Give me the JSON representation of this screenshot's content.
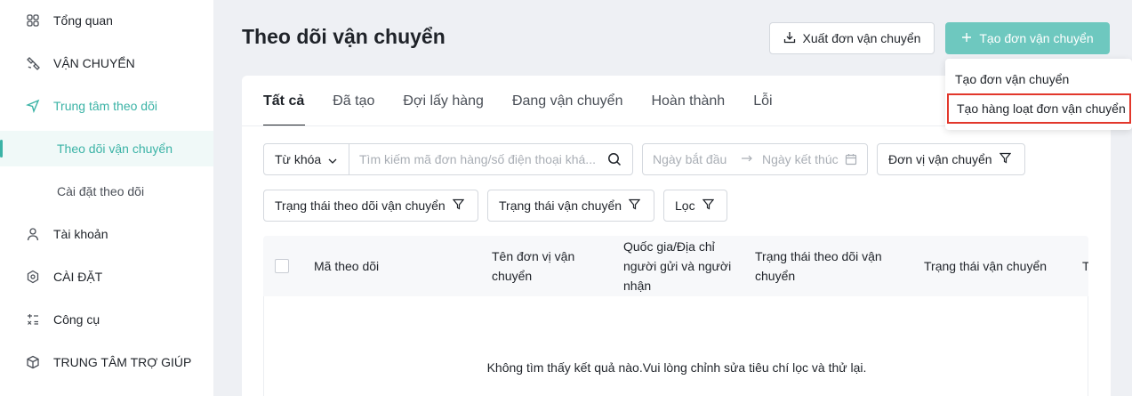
{
  "sidebar": {
    "items": [
      {
        "label": "Tổng quan",
        "icon": "grid-icon"
      },
      {
        "label": "VẬN CHUYỂN",
        "icon": "satellite-icon"
      },
      {
        "label": "Trung tâm theo dõi",
        "icon": "send-icon"
      },
      {
        "label": "Theo dõi vận chuyển"
      },
      {
        "label": "Cài đặt theo dõi"
      },
      {
        "label": "Tài khoản",
        "icon": "user-icon"
      },
      {
        "label": "CÀI ĐẶT",
        "icon": "hexagon-settings-icon"
      },
      {
        "label": "Công cụ",
        "icon": "tools-icon"
      },
      {
        "label": "TRUNG TÂM TRỢ GIÚP",
        "icon": "cube-icon"
      }
    ]
  },
  "header": {
    "title": "Theo dõi vận chuyển",
    "export_label": "Xuất đơn vận chuyển",
    "create_label": "Tạo đơn vận chuyển"
  },
  "dropdown": {
    "items": [
      "Tạo đơn vận chuyển",
      "Tạo hàng loạt đơn vận chuyển"
    ]
  },
  "tabs": [
    "Tất cả",
    "Đã tạo",
    "Đợi lấy hàng",
    "Đang vận chuyển",
    "Hoàn thành",
    "Lỗi"
  ],
  "filters": {
    "keyword_select": "Từ khóa",
    "search_placeholder": "Tìm kiếm mã đơn hàng/số điện thoại khá...",
    "start_date_placeholder": "Ngày bắt đầu",
    "end_date_placeholder": "Ngày kết thúc",
    "carrier": "Đơn vị vận chuyển",
    "tracking_status": "Trạng thái theo dõi vận chuyển",
    "shipping_status": "Trạng thái vận chuyển",
    "filter": "Lọc"
  },
  "table": {
    "columns": [
      "Mã theo dõi",
      "Tên đơn vị vận chuyển",
      "Quốc gia/Địa chỉ người gửi và người nhận",
      "Trạng thái theo dõi vận chuyển",
      "Trạng thái vận chuyển",
      "T"
    ],
    "empty_message": "Không tìm thấy kết quả nào.Vui lòng chỉnh sửa tiêu chí lọc và thử lại."
  },
  "colors": {
    "accent": "#3bb3a6",
    "primary_button": "#6ec8bf",
    "highlight_border": "#e2372b"
  }
}
